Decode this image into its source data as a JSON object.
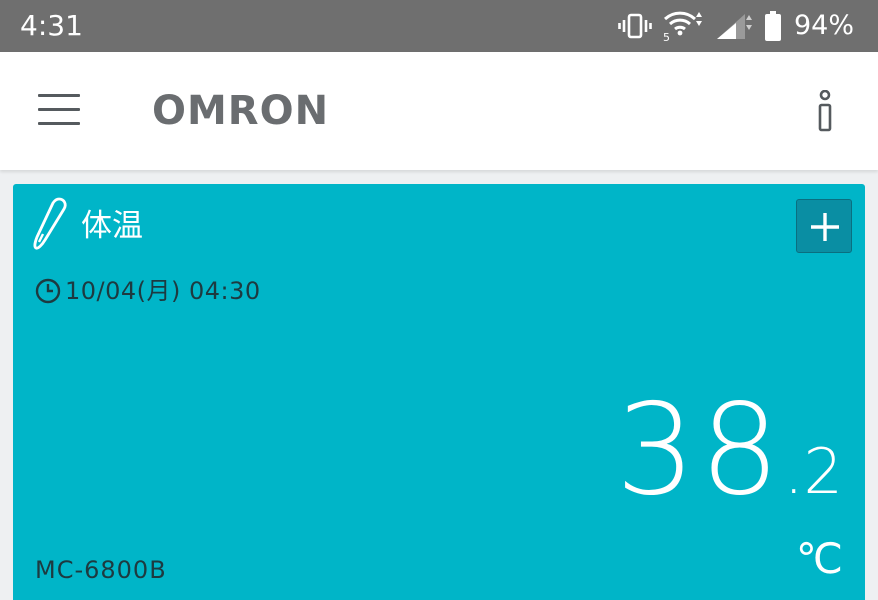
{
  "status_bar": {
    "time": "4:31",
    "battery_percent": "94%",
    "icons": [
      "vibrate-icon",
      "wifi-icon",
      "signal-icon",
      "battery-icon"
    ]
  },
  "app_bar": {
    "brand": "OMRON",
    "icons": [
      "menu-icon",
      "info-icon"
    ]
  },
  "card": {
    "title": "体温",
    "datetime": "10/04(月) 04:30",
    "reading_integer": "38",
    "reading_decimal": ".2",
    "unit": "℃",
    "model": "MC-6800B",
    "colors": {
      "card_background": "#00b5c8",
      "add_button": "#0a8ea3",
      "dark_text": "#1d3a40"
    },
    "icons": [
      "thermometer-icon",
      "plus-icon",
      "clock-icon"
    ]
  }
}
